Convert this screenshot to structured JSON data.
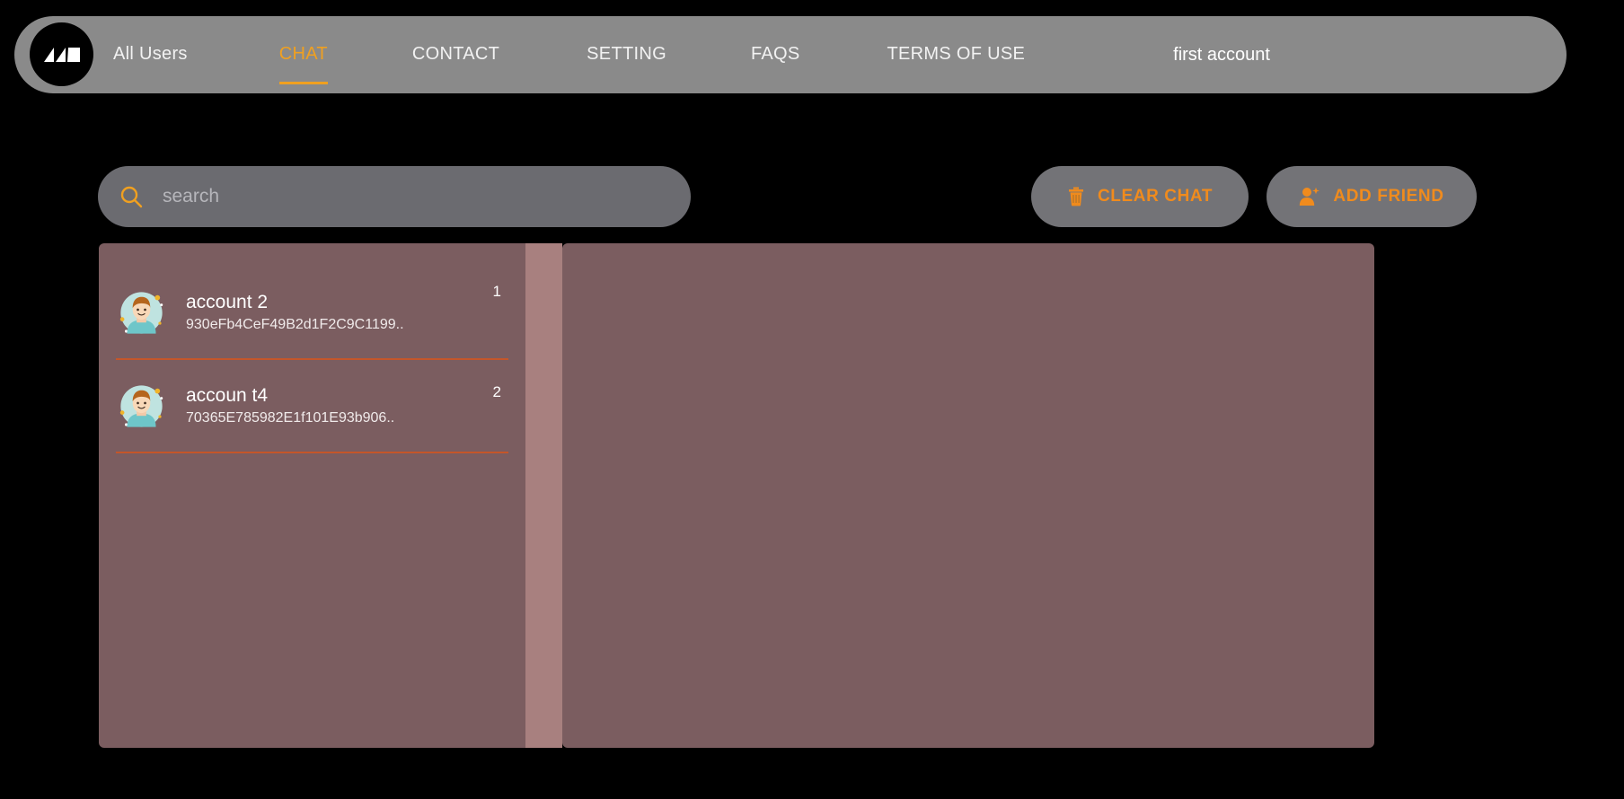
{
  "brand": {
    "logo_icon": "mountain-zigzag-logo",
    "logo_color": "#ffffff",
    "logo_bg": "#000000"
  },
  "navbar": {
    "background": "#8a8a8a",
    "accent": "#f0a020",
    "items": [
      {
        "label": "All Users",
        "active": false
      },
      {
        "label": "CHAT",
        "active": true
      },
      {
        "label": "CONTACT",
        "active": false
      },
      {
        "label": "SETTING",
        "active": false
      },
      {
        "label": "FAQS",
        "active": false
      },
      {
        "label": "TERMS OF USE",
        "active": false
      }
    ],
    "account_label": "first account"
  },
  "toolbar": {
    "search": {
      "icon": "search-icon",
      "value": "",
      "placeholder": "search"
    },
    "clear_chat": {
      "label": "CLEAR CHAT",
      "icon": "trash-icon"
    },
    "add_friend": {
      "label": "ADD FRIEND",
      "icon": "user-plus-icon"
    },
    "button_color": "#f08b1d",
    "button_bg": "#737377"
  },
  "panels": {
    "list_bg": "#7b5d60",
    "divider_bg": "#a8807f",
    "chat_bg": "#7b5d60",
    "row_separator": "#c4562a"
  },
  "chat_list": [
    {
      "avatar": "user-avatar",
      "name": "account 2",
      "address": "930eFb4CeF49B2d1F2C9C1199..",
      "badge": "1"
    },
    {
      "avatar": "user-avatar",
      "name": "accoun t4",
      "address": "70365E785982E1f101E93b906..",
      "badge": "2"
    }
  ]
}
